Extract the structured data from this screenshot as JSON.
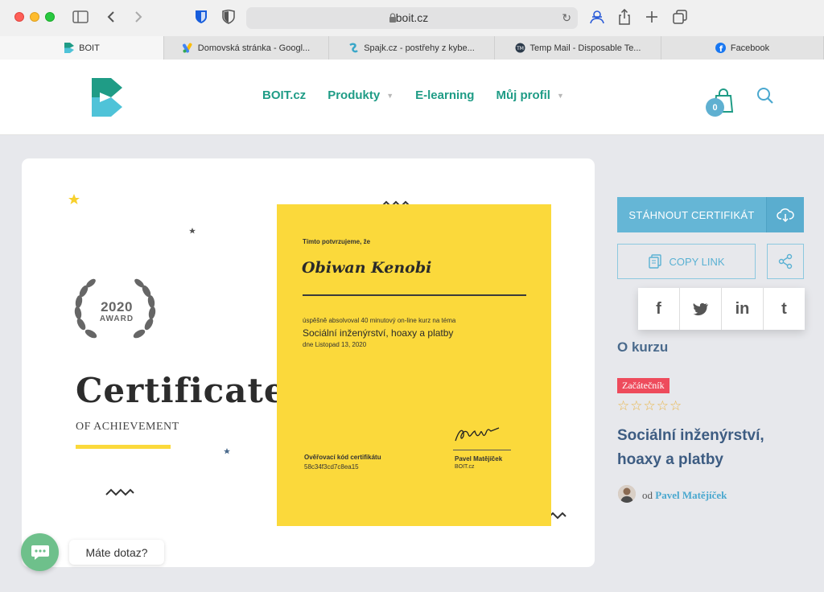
{
  "browser": {
    "url": "boit.cz",
    "tabs": [
      {
        "label": "BOIT",
        "icon": "boit-favicon",
        "active": true
      },
      {
        "label": "Domovská stránka - Googl...",
        "icon": "google-ads-favicon",
        "active": false
      },
      {
        "label": "Spajk.cz - postřehy z kybe...",
        "icon": "spajk-favicon",
        "active": false
      },
      {
        "label": "Temp Mail - Disposable Te...",
        "icon": "tempmail-favicon",
        "active": false
      },
      {
        "label": "Facebook",
        "icon": "facebook-favicon",
        "active": false
      }
    ]
  },
  "header": {
    "nav": [
      {
        "label": "BOIT.cz",
        "dropdown": false
      },
      {
        "label": "Produkty",
        "dropdown": true
      },
      {
        "label": "E-learning",
        "dropdown": false
      },
      {
        "label": "Můj profil",
        "dropdown": true
      }
    ],
    "cart_count": "0"
  },
  "certificate": {
    "award_year": "2020",
    "award_word": "AWARD",
    "title": "Certificate",
    "subtitle": "OF ACHIEVEMENT",
    "intro": "Tímto potvrzujeme, že",
    "recipient": "Obiwan Kenobi",
    "completed": "úspěšně absolvoval 40 minutový on-line kurz na téma",
    "course": "Sociální inženýrství, hoaxy a platby",
    "date": "dne Listopad 13, 2020",
    "code_label": "Ověřovací kód certifikátu",
    "code": "58c34f3cd7c8ea15",
    "signer": "Pavel Matějíček",
    "signer_org": "BOIT.cz"
  },
  "chat": {
    "label": "Máte dotaz?"
  },
  "sidebar": {
    "download_label": "STÁHNOUT CERTIFIKÁT",
    "copy_label": "COPY LINK",
    "social": [
      "f",
      "t",
      "in",
      "t"
    ],
    "about_label": "O kurzu",
    "level_badge": "Začátečník",
    "rating_stars": 0,
    "course_title": "Sociální inženýrství, hoaxy a platby",
    "author_prefix": "od",
    "author_name": "Pavel Matějíček"
  },
  "colors": {
    "brand_green": "#1f9c86",
    "accent_blue": "#65b6d6",
    "cert_yellow": "#fbd93b",
    "badge_red": "#ee4b5c",
    "title_navy": "#3d5c82"
  }
}
